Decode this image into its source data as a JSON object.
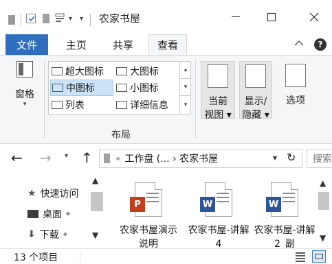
{
  "window": {
    "title": "农家书屋",
    "minimize_icon": "minimize-icon",
    "maximize_icon": "maximize-icon",
    "close_icon": "close-icon"
  },
  "ribbon_tabs": [
    {
      "label": "文件"
    },
    {
      "label": "主页"
    },
    {
      "label": "共享"
    },
    {
      "label": "查看"
    }
  ],
  "ribbon": {
    "pane": {
      "label": "窗格"
    },
    "layout": {
      "group_label": "布局",
      "items": [
        {
          "label": "超大图标"
        },
        {
          "label": "大图标"
        },
        {
          "label": "中图标"
        },
        {
          "label": "小图标"
        },
        {
          "label": "列表"
        },
        {
          "label": "详细信息"
        }
      ],
      "selected": "中图标"
    },
    "current_view": {
      "line1": "当前",
      "line2": "视图 ▾"
    },
    "show_hide": {
      "line1": "显示/",
      "line2": "隐藏 ▾"
    },
    "options": {
      "label": "选项"
    }
  },
  "address_bar": {
    "path_prefix": "«",
    "path": "工作盘 (... › 农家书屋",
    "search_placeholder": "搜索"
  },
  "nav_pane": {
    "items": [
      {
        "label": "快速访问"
      },
      {
        "label": "桌面"
      },
      {
        "label": "下载"
      }
    ]
  },
  "files": [
    {
      "name": "农家书屋演示说明",
      "type": "P"
    },
    {
      "name": "农家书屋-讲解4",
      "type": "W"
    },
    {
      "name": "农家书屋-讲解2_副",
      "type": "W"
    }
  ],
  "status": {
    "count": "13 个项目"
  },
  "colors": {
    "file_tab": "#2f6fbd",
    "selected_layout": "#cce4f7",
    "powerpoint": "#c43e1c",
    "word": "#2b579a"
  }
}
